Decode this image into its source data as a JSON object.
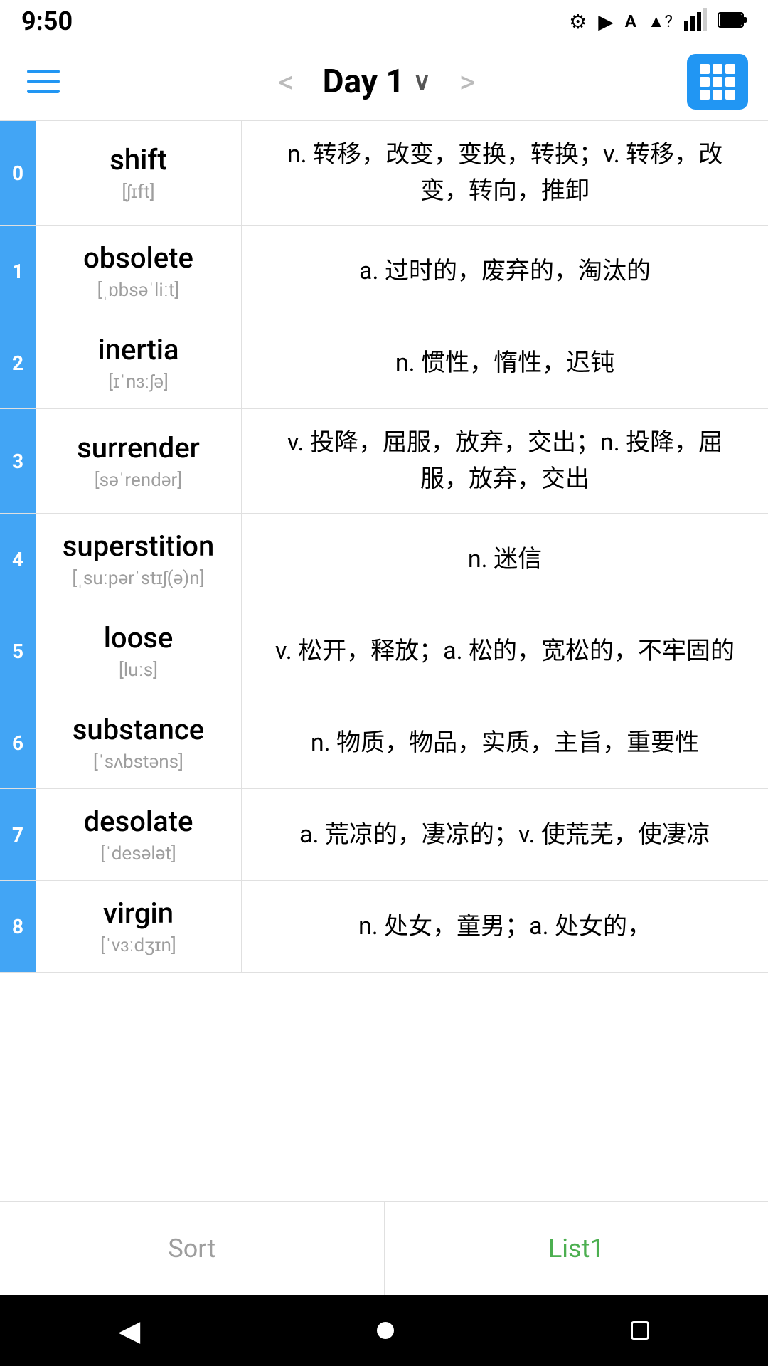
{
  "statusBar": {
    "time": "9:50",
    "icons": [
      "gear",
      "play",
      "A",
      "wifi",
      "signal",
      "battery"
    ]
  },
  "toolbar": {
    "title": "Day 1",
    "prevArrow": "<",
    "nextArrow": ">"
  },
  "words": [
    {
      "index": "0",
      "word": "shift",
      "phonetic": "[ʃɪft]",
      "definition": "n. 转移，改变，变换，转换；v. 转移，改变，转向，推卸"
    },
    {
      "index": "1",
      "word": "obsolete",
      "phonetic": "[ˌɒbsəˈliːt]",
      "definition": "a. 过时的，废弃的，淘汰的"
    },
    {
      "index": "2",
      "word": "inertia",
      "phonetic": "[ɪˈnɜːʃə]",
      "definition": "n. 惯性，惰性，迟钝"
    },
    {
      "index": "3",
      "word": "surrender",
      "phonetic": "[səˈrendər]",
      "definition": "v. 投降，屈服，放弃，交出；n. 投降，屈服，放弃，交出"
    },
    {
      "index": "4",
      "word": "superstition",
      "phonetic": "[ˌsuːpərˈstɪʃ(ə)n]",
      "definition": "n. 迷信"
    },
    {
      "index": "5",
      "word": "loose",
      "phonetic": "[luːs]",
      "definition": "v. 松开，释放；a. 松的，宽松的，不牢固的"
    },
    {
      "index": "6",
      "word": "substance",
      "phonetic": "[ˈsʌbstəns]",
      "definition": "n. 物质，物品，实质，主旨，重要性"
    },
    {
      "index": "7",
      "word": "desolate",
      "phonetic": "[ˈdesələt]",
      "definition": "a. 荒凉的，凄凉的；v. 使荒芜，使凄凉"
    },
    {
      "index": "8",
      "word": "virgin",
      "phonetic": "[ˈvɜːdʒɪn]",
      "definition": "n. 处女，童男；a. 处女的，"
    }
  ],
  "bottomTabs": [
    {
      "label": "Sort",
      "active": false
    },
    {
      "label": "List1",
      "active": true
    }
  ],
  "navBar": {
    "backLabel": "◀",
    "homeLabel": "●",
    "recentLabel": "■"
  }
}
